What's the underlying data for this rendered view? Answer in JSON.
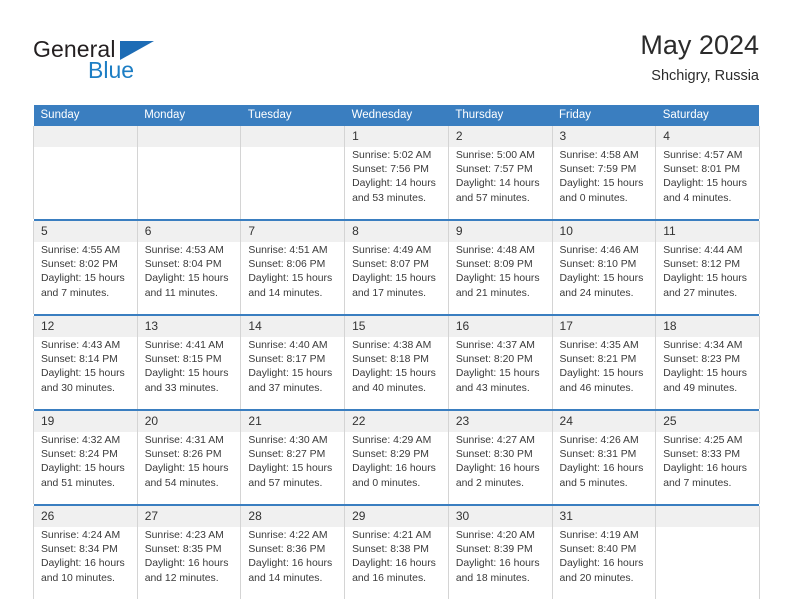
{
  "brand": {
    "name_part1": "General",
    "name_part2": "Blue",
    "triangle_icon": "triangle-icon",
    "colors": {
      "dark": "#231f20",
      "blue": "#1d7ec4",
      "header_blue": "#3a7ec0"
    }
  },
  "header": {
    "title": "May 2024",
    "subtitle": "Shchigry, Russia"
  },
  "weekday_headers": [
    "Sunday",
    "Monday",
    "Tuesday",
    "Wednesday",
    "Thursday",
    "Friday",
    "Saturday"
  ],
  "weeks": [
    [
      {
        "day": "",
        "lines": []
      },
      {
        "day": "",
        "lines": []
      },
      {
        "day": "",
        "lines": []
      },
      {
        "day": "1",
        "lines": [
          "Sunrise: 5:02 AM",
          "Sunset: 7:56 PM",
          "Daylight: 14 hours",
          "and 53 minutes."
        ]
      },
      {
        "day": "2",
        "lines": [
          "Sunrise: 5:00 AM",
          "Sunset: 7:57 PM",
          "Daylight: 14 hours",
          "and 57 minutes."
        ]
      },
      {
        "day": "3",
        "lines": [
          "Sunrise: 4:58 AM",
          "Sunset: 7:59 PM",
          "Daylight: 15 hours",
          "and 0 minutes."
        ]
      },
      {
        "day": "4",
        "lines": [
          "Sunrise: 4:57 AM",
          "Sunset: 8:01 PM",
          "Daylight: 15 hours",
          "and 4 minutes."
        ]
      }
    ],
    [
      {
        "day": "5",
        "lines": [
          "Sunrise: 4:55 AM",
          "Sunset: 8:02 PM",
          "Daylight: 15 hours",
          "and 7 minutes."
        ]
      },
      {
        "day": "6",
        "lines": [
          "Sunrise: 4:53 AM",
          "Sunset: 8:04 PM",
          "Daylight: 15 hours",
          "and 11 minutes."
        ]
      },
      {
        "day": "7",
        "lines": [
          "Sunrise: 4:51 AM",
          "Sunset: 8:06 PM",
          "Daylight: 15 hours",
          "and 14 minutes."
        ]
      },
      {
        "day": "8",
        "lines": [
          "Sunrise: 4:49 AM",
          "Sunset: 8:07 PM",
          "Daylight: 15 hours",
          "and 17 minutes."
        ]
      },
      {
        "day": "9",
        "lines": [
          "Sunrise: 4:48 AM",
          "Sunset: 8:09 PM",
          "Daylight: 15 hours",
          "and 21 minutes."
        ]
      },
      {
        "day": "10",
        "lines": [
          "Sunrise: 4:46 AM",
          "Sunset: 8:10 PM",
          "Daylight: 15 hours",
          "and 24 minutes."
        ]
      },
      {
        "day": "11",
        "lines": [
          "Sunrise: 4:44 AM",
          "Sunset: 8:12 PM",
          "Daylight: 15 hours",
          "and 27 minutes."
        ]
      }
    ],
    [
      {
        "day": "12",
        "lines": [
          "Sunrise: 4:43 AM",
          "Sunset: 8:14 PM",
          "Daylight: 15 hours",
          "and 30 minutes."
        ]
      },
      {
        "day": "13",
        "lines": [
          "Sunrise: 4:41 AM",
          "Sunset: 8:15 PM",
          "Daylight: 15 hours",
          "and 33 minutes."
        ]
      },
      {
        "day": "14",
        "lines": [
          "Sunrise: 4:40 AM",
          "Sunset: 8:17 PM",
          "Daylight: 15 hours",
          "and 37 minutes."
        ]
      },
      {
        "day": "15",
        "lines": [
          "Sunrise: 4:38 AM",
          "Sunset: 8:18 PM",
          "Daylight: 15 hours",
          "and 40 minutes."
        ]
      },
      {
        "day": "16",
        "lines": [
          "Sunrise: 4:37 AM",
          "Sunset: 8:20 PM",
          "Daylight: 15 hours",
          "and 43 minutes."
        ]
      },
      {
        "day": "17",
        "lines": [
          "Sunrise: 4:35 AM",
          "Sunset: 8:21 PM",
          "Daylight: 15 hours",
          "and 46 minutes."
        ]
      },
      {
        "day": "18",
        "lines": [
          "Sunrise: 4:34 AM",
          "Sunset: 8:23 PM",
          "Daylight: 15 hours",
          "and 49 minutes."
        ]
      }
    ],
    [
      {
        "day": "19",
        "lines": [
          "Sunrise: 4:32 AM",
          "Sunset: 8:24 PM",
          "Daylight: 15 hours",
          "and 51 minutes."
        ]
      },
      {
        "day": "20",
        "lines": [
          "Sunrise: 4:31 AM",
          "Sunset: 8:26 PM",
          "Daylight: 15 hours",
          "and 54 minutes."
        ]
      },
      {
        "day": "21",
        "lines": [
          "Sunrise: 4:30 AM",
          "Sunset: 8:27 PM",
          "Daylight: 15 hours",
          "and 57 minutes."
        ]
      },
      {
        "day": "22",
        "lines": [
          "Sunrise: 4:29 AM",
          "Sunset: 8:29 PM",
          "Daylight: 16 hours",
          "and 0 minutes."
        ]
      },
      {
        "day": "23",
        "lines": [
          "Sunrise: 4:27 AM",
          "Sunset: 8:30 PM",
          "Daylight: 16 hours",
          "and 2 minutes."
        ]
      },
      {
        "day": "24",
        "lines": [
          "Sunrise: 4:26 AM",
          "Sunset: 8:31 PM",
          "Daylight: 16 hours",
          "and 5 minutes."
        ]
      },
      {
        "day": "25",
        "lines": [
          "Sunrise: 4:25 AM",
          "Sunset: 8:33 PM",
          "Daylight: 16 hours",
          "and 7 minutes."
        ]
      }
    ],
    [
      {
        "day": "26",
        "lines": [
          "Sunrise: 4:24 AM",
          "Sunset: 8:34 PM",
          "Daylight: 16 hours",
          "and 10 minutes."
        ]
      },
      {
        "day": "27",
        "lines": [
          "Sunrise: 4:23 AM",
          "Sunset: 8:35 PM",
          "Daylight: 16 hours",
          "and 12 minutes."
        ]
      },
      {
        "day": "28",
        "lines": [
          "Sunrise: 4:22 AM",
          "Sunset: 8:36 PM",
          "Daylight: 16 hours",
          "and 14 minutes."
        ]
      },
      {
        "day": "29",
        "lines": [
          "Sunrise: 4:21 AM",
          "Sunset: 8:38 PM",
          "Daylight: 16 hours",
          "and 16 minutes."
        ]
      },
      {
        "day": "30",
        "lines": [
          "Sunrise: 4:20 AM",
          "Sunset: 8:39 PM",
          "Daylight: 16 hours",
          "and 18 minutes."
        ]
      },
      {
        "day": "31",
        "lines": [
          "Sunrise: 4:19 AM",
          "Sunset: 8:40 PM",
          "Daylight: 16 hours",
          "and 20 minutes."
        ]
      },
      {
        "day": "",
        "lines": []
      }
    ]
  ]
}
